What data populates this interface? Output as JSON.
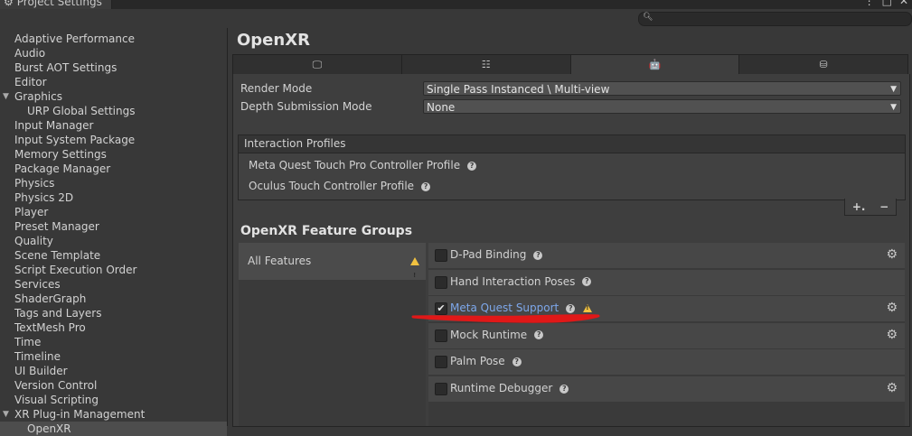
{
  "window": {
    "title": "Project Settings",
    "controls": [
      "⋮",
      "□",
      "✕"
    ]
  },
  "search": {
    "placeholder": ""
  },
  "sidebar": {
    "items": [
      {
        "label": "Adaptive Performance",
        "indent": 0
      },
      {
        "label": "Audio",
        "indent": 0
      },
      {
        "label": "Burst AOT Settings",
        "indent": 0
      },
      {
        "label": "Editor",
        "indent": 0
      },
      {
        "label": "Graphics",
        "indent": 0,
        "expanded": true
      },
      {
        "label": "URP Global Settings",
        "indent": 1
      },
      {
        "label": "Input Manager",
        "indent": 0
      },
      {
        "label": "Input System Package",
        "indent": 0
      },
      {
        "label": "Memory Settings",
        "indent": 0
      },
      {
        "label": "Package Manager",
        "indent": 0
      },
      {
        "label": "Physics",
        "indent": 0
      },
      {
        "label": "Physics 2D",
        "indent": 0
      },
      {
        "label": "Player",
        "indent": 0
      },
      {
        "label": "Preset Manager",
        "indent": 0
      },
      {
        "label": "Quality",
        "indent": 0
      },
      {
        "label": "Scene Template",
        "indent": 0
      },
      {
        "label": "Script Execution Order",
        "indent": 0
      },
      {
        "label": "Services",
        "indent": 0
      },
      {
        "label": "ShaderGraph",
        "indent": 0
      },
      {
        "label": "Tags and Layers",
        "indent": 0
      },
      {
        "label": "TextMesh Pro",
        "indent": 0
      },
      {
        "label": "Time",
        "indent": 0
      },
      {
        "label": "Timeline",
        "indent": 0
      },
      {
        "label": "UI Builder",
        "indent": 0
      },
      {
        "label": "Version Control",
        "indent": 0
      },
      {
        "label": "Visual Scripting",
        "indent": 0
      },
      {
        "label": "XR Plug-in Management",
        "indent": 0,
        "expanded": true
      },
      {
        "label": "OpenXR",
        "indent": 1,
        "selected": true
      }
    ]
  },
  "main": {
    "title": "OpenXR",
    "tabs": [
      {
        "icon": "monitor-icon",
        "glyph": "🖵",
        "active": false
      },
      {
        "icon": "server-icon",
        "glyph": "☷",
        "active": false
      },
      {
        "icon": "android-icon",
        "glyph": "🤖",
        "active": true
      },
      {
        "icon": "webgl-icon",
        "glyph": "⛁",
        "active": false
      }
    ],
    "render_mode": {
      "label": "Render Mode",
      "value": "Single Pass Instanced \\ Multi-view"
    },
    "depth_mode": {
      "label": "Depth Submission Mode",
      "value": "None"
    },
    "interaction_profiles": {
      "header": "Interaction Profiles",
      "items": [
        "Meta Quest Touch Pro Controller Profile",
        "Oculus Touch Controller Profile"
      ],
      "add": "+.",
      "remove": "−"
    },
    "feature_groups": {
      "title": "OpenXR Feature Groups",
      "groups": [
        {
          "label": "All Features",
          "warning": true
        }
      ]
    },
    "features": [
      {
        "label": "D-Pad Binding",
        "checked": false,
        "gear": true,
        "warning": false,
        "link": false
      },
      {
        "label": "Hand Interaction Poses",
        "checked": false,
        "gear": false,
        "warning": false,
        "link": false
      },
      {
        "label": "Meta Quest Support",
        "checked": true,
        "gear": true,
        "warning": true,
        "link": true
      },
      {
        "label": "Mock Runtime",
        "checked": false,
        "gear": true,
        "warning": false,
        "link": false
      },
      {
        "label": "Palm Pose",
        "checked": false,
        "gear": false,
        "warning": false,
        "link": false
      },
      {
        "label": "Runtime Debugger",
        "checked": false,
        "gear": true,
        "warning": false,
        "link": false
      }
    ]
  },
  "colors": {
    "accent_link": "#7da7ea",
    "warning": "#f2c240",
    "annotation": "#e01818"
  }
}
